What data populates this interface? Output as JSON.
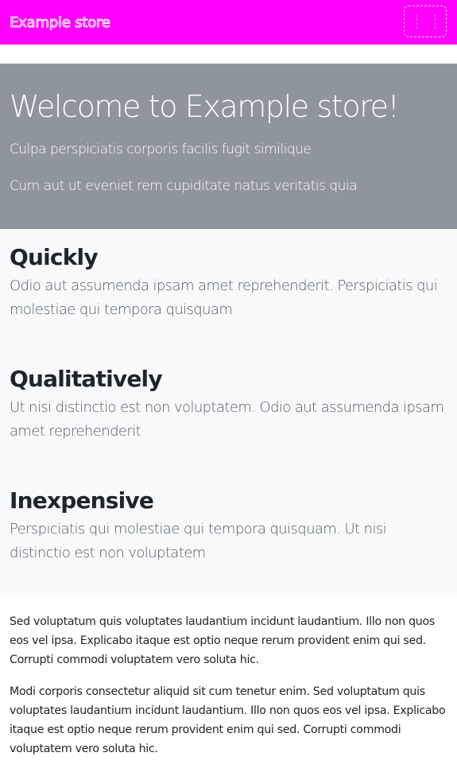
{
  "navbar": {
    "brand": "Example store",
    "toggler_icon": "hamburger-icon",
    "background_color": "#ff00ff"
  },
  "hero": {
    "title": "Welcome to Example store!",
    "lines": [
      "Culpa perspiciatis corporis facilis fugit similique",
      "Cum aut ut eveniet rem cupiditate natus veritatis quia"
    ],
    "background_color": "#8f959d"
  },
  "features": [
    {
      "title": "Quickly",
      "text": "Odio aut assumenda ipsam amet reprehenderit. Perspiciatis qui molestiae qui tempora quisquam"
    },
    {
      "title": "Qualitatively",
      "text": "Ut nisi distinctio est non voluptatem. Odio aut assumenda ipsam amet reprehenderit"
    },
    {
      "title": "Inexpensive",
      "text": "Perspiciatis qui molestiae qui tempora quisquam. Ut nisi distinctio est non voluptatem"
    }
  ],
  "content": {
    "paragraphs": [
      "Sed voluptatum quis voluptates laudantium incidunt laudantium. Illo non quos eos vel ipsa. Explicabo itaque est optio neque rerum provident enim qui sed. Corrupti commodi voluptatem vero soluta hic.",
      "Modi corporis consectetur aliquid sit cum tenetur enim. Sed voluptatum quis voluptates laudantium incidunt laudantium. Illo non quos eos vel ipsa. Explicabo itaque est optio neque rerum provident enim qui sed. Corrupti commodi voluptatem vero soluta hic."
    ]
  }
}
